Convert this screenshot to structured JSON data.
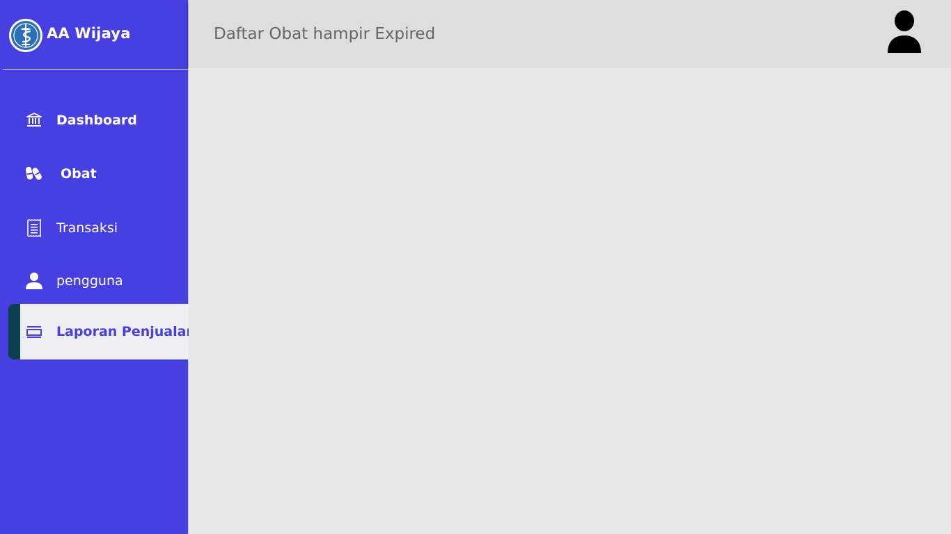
{
  "brand": {
    "name": "AA Wijaya",
    "logo_icon": "caduceus-pharmacy-logo"
  },
  "sidebar": {
    "items": [
      {
        "label": "Dashboard",
        "icon": "bank-icon",
        "active": false
      },
      {
        "label": "Obat",
        "icon": "pills-icon",
        "active": false
      },
      {
        "label": "Transaksi",
        "icon": "receipt-icon",
        "active": false
      },
      {
        "label": "pengguna",
        "icon": "user-icon",
        "active": false
      },
      {
        "label": "Laporan Penjualan",
        "icon": "report-icon",
        "active": true
      }
    ]
  },
  "header": {
    "title": "Daftar Obat hampir Expired",
    "avatar_icon": "user-avatar-icon"
  },
  "colors": {
    "sidebar_bg": "#473fdf",
    "active_bg": "#efeff1",
    "active_accent": "#0c3f52",
    "header_bg": "#dedede",
    "content_bg": "#e8e8e8",
    "title_text": "#666666"
  }
}
